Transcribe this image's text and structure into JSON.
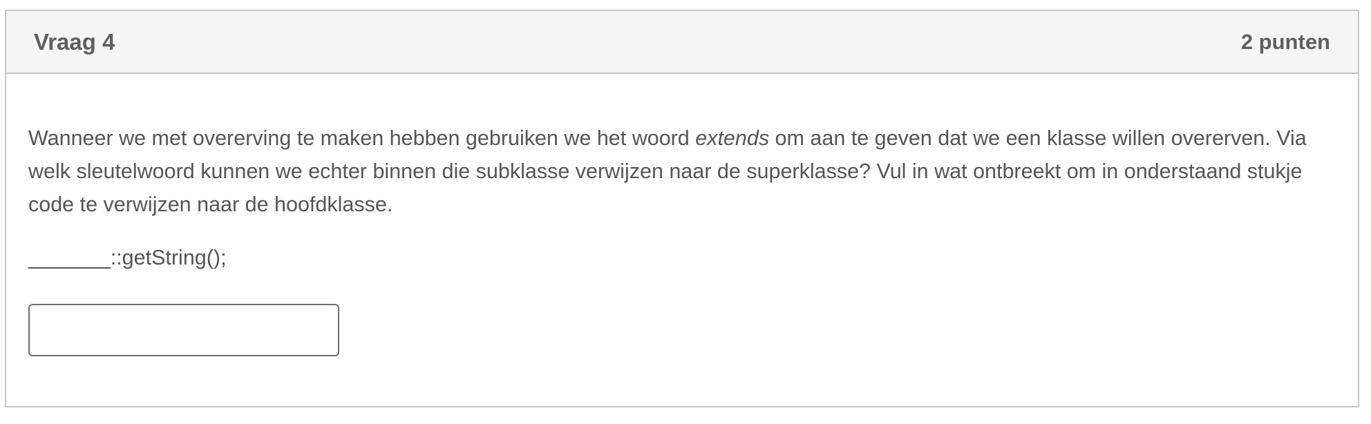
{
  "question": {
    "title": "Vraag 4",
    "points": "2 punten",
    "text_part1": "Wanneer we met overerving te maken hebben gebruiken we het woord ",
    "text_emphasis": "extends",
    "text_part2": " om aan te geven dat we een klasse willen overerven. Via welk sleutelwoord kunnen we echter binnen die subklasse verwijzen naar de superklasse? Vul in wat ontbreekt om in onderstaand stukje code te verwijzen naar de hoofdklasse.",
    "code_line": "_______::getString();",
    "answer_value": "",
    "answer_placeholder": ""
  }
}
